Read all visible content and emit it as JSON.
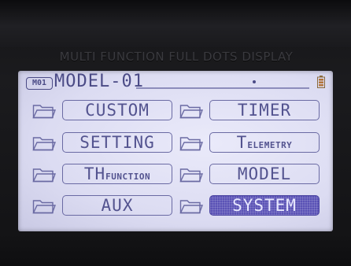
{
  "bezel": {
    "caption": "MULTI FUNCTION FULL DOTS DISPLAY"
  },
  "header": {
    "model_badge": "M01",
    "model_name": "MODEL-01",
    "icons": {
      "battery": "battery-icon",
      "status_dot": "dot-indicator"
    }
  },
  "menu": {
    "items": [
      {
        "large": "CUSTOM",
        "small": "",
        "selected": false
      },
      {
        "large": "TIMER",
        "small": "",
        "selected": false
      },
      {
        "large": "SETTING",
        "small": "",
        "selected": false
      },
      {
        "large": "T",
        "small": "ELEMETRY",
        "selected": false
      },
      {
        "large": "TH",
        "small": "FUNCTION",
        "selected": false
      },
      {
        "large": "MODEL",
        "small": "",
        "selected": false
      },
      {
        "large": "AUX",
        "small": "",
        "selected": false
      },
      {
        "large": "SYSTEM",
        "small": "",
        "selected": true
      }
    ],
    "icon": "folder-icon"
  },
  "colors": {
    "lcd_background": "#dcdcf2",
    "lcd_text": "#53538f",
    "selection": "#5a52b6",
    "bezel": "#1b1b1e"
  }
}
